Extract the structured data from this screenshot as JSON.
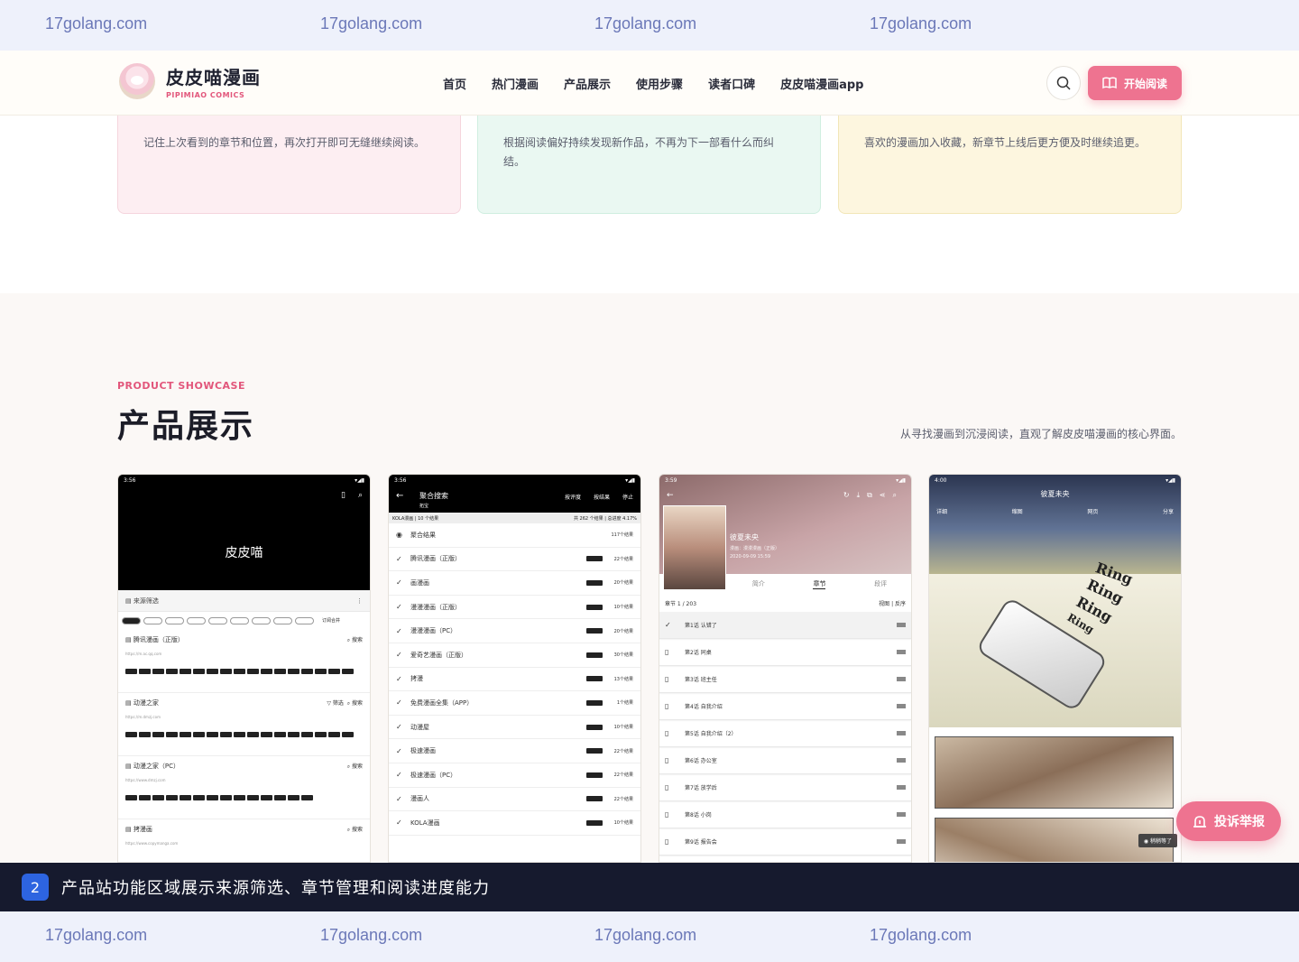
{
  "watermark": {
    "text": "17golang.com"
  },
  "header": {
    "logo_title": "皮皮喵漫画",
    "logo_sub": "PIPIMIAO COMICS",
    "nav": [
      "首页",
      "热门漫画",
      "产品展示",
      "使用步骤",
      "读者口碑",
      "皮皮喵漫画app"
    ],
    "cta": "开始阅读"
  },
  "features": [
    {
      "text": "记住上次看到的章节和位置，再次打开即可无缝继续阅读。"
    },
    {
      "text": "根据阅读偏好持续发现新作品，不再为下一部看什么而纠结。"
    },
    {
      "text": "喜欢的漫画加入收藏，新章节上线后更方便及时继续追更。"
    }
  ],
  "showcase": {
    "kicker": "PRODUCT SHOWCASE",
    "title": "产品展示",
    "desc": "从寻找漫画到沉浸阅读，直观了解皮皮喵漫画的核心界面。"
  },
  "phone1": {
    "time": "3:56",
    "title": "皮皮喵",
    "bar_label": "来源筛选",
    "sort_label": "订阅合并",
    "sources": [
      {
        "name": "腾讯漫画（正版）",
        "action": "搜索",
        "url": "https://m.ac.qq.com"
      },
      {
        "name": "动漫之家",
        "action": "搜索",
        "filter": "筛选",
        "url": "https://m.dmzj.com"
      },
      {
        "name": "动漫之家（PC）",
        "action": "搜索",
        "url": "https://www.dmzj.com"
      },
      {
        "name": "拷漫画",
        "action": "搜索",
        "url": "https://www.copymanga.com"
      }
    ]
  },
  "phone2": {
    "time": "3:56",
    "title": "聚合搜索",
    "subtitle": "拓宝",
    "acts": [
      "按评度",
      "按结果",
      "停止"
    ],
    "summary_left": "KOLA漫画 | 10 个结果",
    "summary_right": "共 262 个结果 | 总进度 4.17%",
    "rows": [
      {
        "name": "聚合结果",
        "count": "117个结果"
      },
      {
        "name": "腾讯漫画（正版）",
        "count": "22个结果"
      },
      {
        "name": "画漫画",
        "count": "20个结果"
      },
      {
        "name": "漫漫漫画（正版）",
        "count": "10个结果"
      },
      {
        "name": "漫漫漫画（PC）",
        "count": "20个结果"
      },
      {
        "name": "爱奇艺漫画（正版）",
        "count": "30个结果"
      },
      {
        "name": "拷漫",
        "count": "13个结果"
      },
      {
        "name": "免费漫画全集（APP）",
        "count": "1个结果"
      },
      {
        "name": "动漫屋",
        "count": "10个结果"
      },
      {
        "name": "极速漫画",
        "count": "22个结果"
      },
      {
        "name": "极速漫画（PC）",
        "count": "22个结果"
      },
      {
        "name": "漫画人",
        "count": "22个结果"
      },
      {
        "name": "KOLA漫画",
        "count": "10个结果"
      }
    ]
  },
  "phone3": {
    "time": "3:59",
    "title": "彼夏未央",
    "author": "漫画：漫漫漫画（正版）",
    "date": "2020-09-09 15:59",
    "tabs": [
      "简介",
      "章节",
      "段评"
    ],
    "chapter_count": "章节 1 / 203",
    "chapter_view": "视图 | 反序",
    "chapters": [
      "第1话 认错了",
      "第2话 同桌",
      "第3话 班主任",
      "第4话 自我介绍",
      "第5话 自我介绍（2）",
      "第6话 办公室",
      "第7话 放学后",
      "第8话 小岗",
      "第9话 报告会"
    ]
  },
  "phone4": {
    "time": "4:00",
    "title": "彼夏未央",
    "tb": [
      "详细",
      "缩图",
      "网页",
      "分享"
    ],
    "ring": "Ring",
    "tag": "稍稍等了"
  },
  "report": {
    "label": "投诉举报"
  },
  "caption": {
    "num": "2",
    "text": "产品站功能区域展示来源筛选、章节管理和阅读进度能力"
  }
}
